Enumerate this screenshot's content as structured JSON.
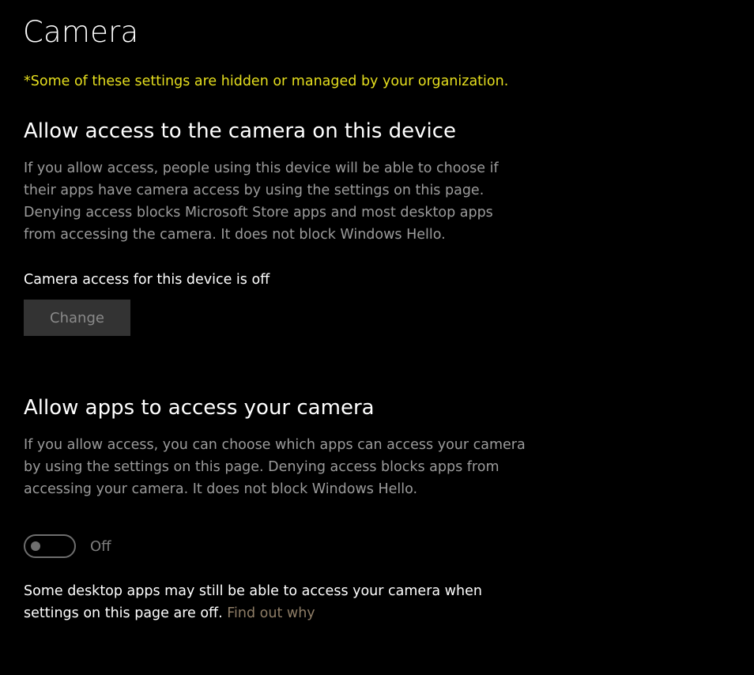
{
  "page": {
    "title": "Camera",
    "org_notice": "*Some of these settings are hidden or managed by your organization."
  },
  "device_access": {
    "heading": "Allow access to the camera on this device",
    "description_lines": [
      "If you allow access, people using this device will be able to choose if",
      "their apps have camera access by using the settings on this page.",
      "Denying access blocks Microsoft Store apps and most desktop apps",
      "from accessing the camera. It does not block Windows Hello."
    ],
    "status": "Camera access for this device is off",
    "change_label": "Change"
  },
  "app_access": {
    "heading": "Allow apps to access your camera",
    "description_lines": [
      "If you allow access, you can choose which apps can access your camera",
      "by using the settings on this page. Denying access blocks apps from",
      "accessing your camera. It does not block Windows Hello."
    ],
    "toggle_state": "Off",
    "toggle_on": false
  },
  "footnote": {
    "line1": "Some desktop apps may still be able to access your camera when",
    "line2_text": "settings on this page are off.",
    "link_label": "Find out why"
  },
  "colors": {
    "background": "#000000",
    "notice": "#e6df1e",
    "secondary_text": "#9b9b9b",
    "link": "#8e7d66"
  }
}
